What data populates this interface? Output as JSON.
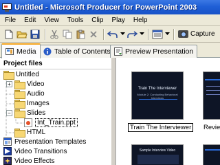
{
  "window": {
    "title": "Untitled - Microsoft Producer for PowerPoint 2003"
  },
  "menu": [
    "File",
    "Edit",
    "View",
    "Tools",
    "Clip",
    "Play",
    "Help"
  ],
  "toolbar": {
    "capture_label": "Capture"
  },
  "tabs": [
    {
      "label": "Media",
      "active": true
    },
    {
      "label": "Table of Contents",
      "active": false
    },
    {
      "label": "Preview Presentation",
      "active": false
    }
  ],
  "project_files": {
    "header": "Project files",
    "tree": [
      {
        "label": "Untitled"
      },
      {
        "label": "Video"
      },
      {
        "label": "Audio"
      },
      {
        "label": "Images"
      },
      {
        "label": "Slides"
      },
      {
        "label": "Int_Train.ppt"
      },
      {
        "label": "HTML"
      },
      {
        "label": "Presentation Templates"
      },
      {
        "label": "Video Transitions"
      },
      {
        "label": "Video Effects"
      }
    ]
  },
  "thumbnails": [
    {
      "caption": "Train The Interviewer",
      "slide_title": "Train The Interviewer",
      "slide_subtitle": "Module 2: Conducting Behavioral Interviews"
    },
    {
      "caption": "Review"
    },
    {
      "slide_title": "Sample Interview Video"
    }
  ],
  "colors": {
    "titlebar": "#1f5fd6",
    "tab_accent": "#f5a623",
    "slide_bg": "#0e1526"
  }
}
